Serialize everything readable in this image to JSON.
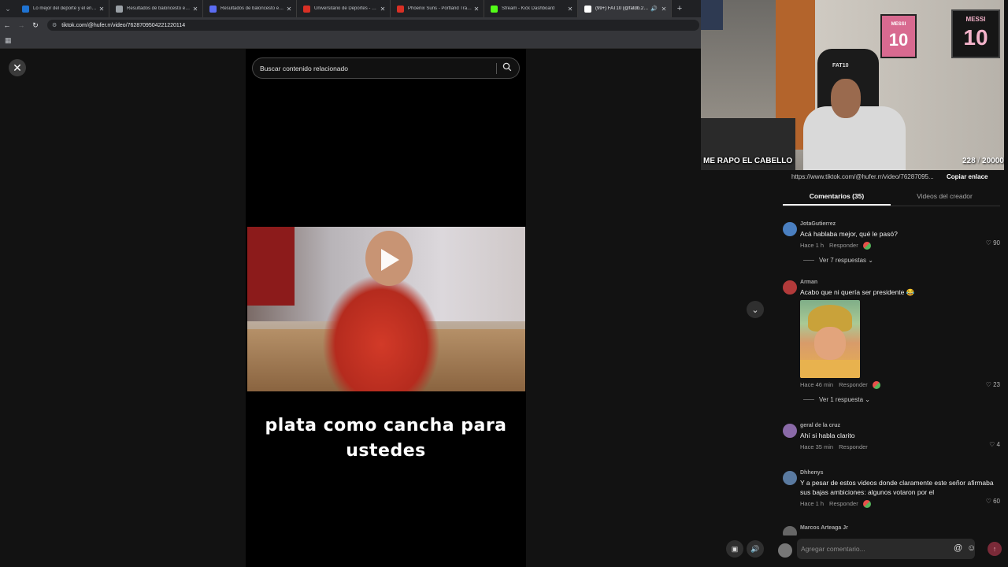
{
  "browser": {
    "tabs": [
      {
        "title": "Lo mejor del deporte y el entretenimiento",
        "favicon_color": "#1f73d2",
        "active": false
      },
      {
        "title": "Resultados de baloncesto en vivo",
        "favicon_color": "#9aa0a6",
        "active": false
      },
      {
        "title": "Resultados de baloncesto en directo",
        "favicon_color": "#5b6cf2",
        "active": false
      },
      {
        "title": "Universitario de Deportes - Col",
        "favicon_color": "#d93025",
        "active": false
      },
      {
        "title": "Phoenix Suns - Portland Trail Blazers",
        "favicon_color": "#d93025",
        "active": false
      },
      {
        "title": "Stream - Kick Dashboard",
        "favicon_color": "#53fc18",
        "active": false
      },
      {
        "title": "(99+) FAT10 (@fatdb.25) | TikTok",
        "favicon_color": "#ffffff",
        "active": true
      }
    ],
    "close_glyph": "✕",
    "new_tab_glyph": "+",
    "url": "tiktok.com/@hufer.rr/video/7628709504221220114"
  },
  "player": {
    "close_glyph": "✕",
    "search_placeholder": "Buscar contenido relacionado",
    "caption_line1": "plata como cancha para",
    "caption_line2": "ustedes"
  },
  "stream_overlay": {
    "title": "ME RAPO EL CABELLO",
    "count_current": "228",
    "count_separator": "/",
    "count_goal": "20000",
    "poster1_text": "MESSI",
    "poster1_number": "10",
    "poster2_text": "MESSI",
    "poster2_number": "10",
    "chair_label": "FAT10"
  },
  "share": {
    "url": "https://www.tiktok.com/@hufer.rr/video/76287095...",
    "copy_label": "Copiar enlace"
  },
  "panel_tabs": {
    "comments": "Comentarios (35)",
    "creator_videos": "Videos del creador"
  },
  "comments": [
    {
      "user": "JotaGutierrez",
      "text": "Acá hablaba mejor, qué le pasó?",
      "time": "Hace 1 h",
      "reply": "Responder",
      "likes": "90",
      "more": "Ver 7 respuestas",
      "avatar_color": "#4a7fc0"
    },
    {
      "user": "Arman",
      "text": "Acabo que ni quería ser presidente 😂",
      "time": "Hace 46 min",
      "reply": "Responder",
      "likes": "23",
      "more": "Ver 1 respuesta",
      "avatar_color": "#b23a3a"
    },
    {
      "user": "geral de la cruz",
      "text": "Ahí si habla clarito",
      "time": "Hace 35 min",
      "reply": "Responder",
      "likes": "4",
      "avatar_color": "#8a6aa8"
    },
    {
      "user": "Dhhenys",
      "text": "Y a pesar de estos videos donde claramente este señor afirmaba sus bajas ambiciones: algunos votaron por el",
      "time": "Hace 1 h",
      "reply": "Responder",
      "likes": "60",
      "avatar_color": "#5a7aa0"
    },
    {
      "user": "Marcos Arteaga Jr",
      "avatar_color": "#666666"
    }
  ],
  "composer": {
    "placeholder": "Agregar comentario...",
    "at_glyph": "@",
    "emoji_glyph": "☺",
    "send_glyph": "↑"
  },
  "icons": {
    "heart": "♡",
    "chevron": "⌄",
    "scroll_down": "⌄",
    "play": "play-icon",
    "search": "search-icon"
  }
}
